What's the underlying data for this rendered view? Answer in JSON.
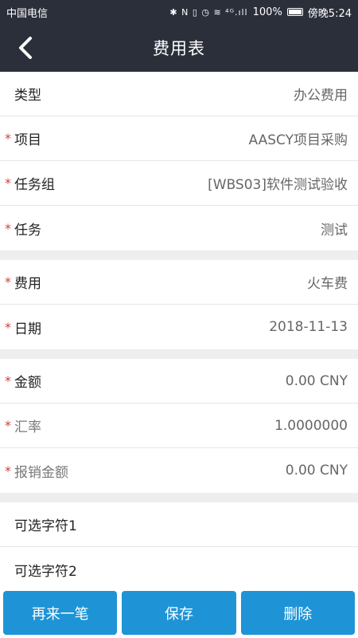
{
  "status_bar": {
    "carrier": "中国电信",
    "icons_text": "✱ N ▯ ◷ ≋ ⁴ᴳ.ıll",
    "battery_percent": "100%",
    "time": "傍晚5:24"
  },
  "header": {
    "title": "费用表",
    "back_icon": "chevron-left-icon"
  },
  "groups": [
    {
      "rows": [
        {
          "name": "type",
          "required": false,
          "label": "类型",
          "value": "办公费用"
        },
        {
          "name": "project",
          "required": true,
          "label": "项目",
          "value": "AASCY项目采购"
        },
        {
          "name": "task-group",
          "required": true,
          "label": "任务组",
          "value": "[WBS03]软件测试验收"
        },
        {
          "name": "task",
          "required": true,
          "label": "任务",
          "value": "测试"
        }
      ]
    },
    {
      "rows": [
        {
          "name": "expense",
          "required": true,
          "label": "费用",
          "value": "火车费"
        },
        {
          "name": "date",
          "required": true,
          "label": "日期",
          "value": "2018-11-13"
        }
      ]
    },
    {
      "rows": [
        {
          "name": "amount",
          "required": true,
          "label": "金额",
          "value": "0.00   CNY"
        },
        {
          "name": "exchange-rate",
          "required": true,
          "label": "汇率",
          "value": "1.0000000",
          "muted": true
        },
        {
          "name": "reimbursement-amount",
          "required": true,
          "label": "报销金额",
          "value": "0.00   CNY",
          "muted": true
        }
      ]
    },
    {
      "rows": [
        {
          "name": "optional-char-1",
          "required": false,
          "label": "可选字符1",
          "value": ""
        },
        {
          "name": "optional-char-2",
          "required": false,
          "label": "可选字符2",
          "value": ""
        }
      ]
    }
  ],
  "required_marker": "*",
  "buttons": {
    "add_another": "再来一笔",
    "save": "保存",
    "delete": "删除"
  },
  "colors": {
    "header_bg": "#2b2f3a",
    "button_bg": "#1e94d6",
    "required": "#d0433a"
  }
}
